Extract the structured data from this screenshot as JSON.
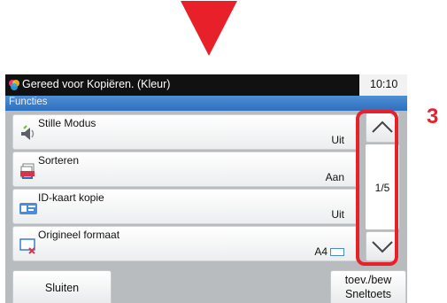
{
  "status_bar": {
    "status_text": "Gereed voor Kopiëren. (Kleur)",
    "time": "10:10",
    "status_icon": "color-copy-icon"
  },
  "header": {
    "title": "Functies"
  },
  "functions": [
    {
      "label": "Stille Modus",
      "value": "Uit",
      "icon": "quiet-mode-icon"
    },
    {
      "label": "Sorteren",
      "value": "Aan",
      "icon": "collate-icon"
    },
    {
      "label": "ID-kaart kopie",
      "value": "Uit",
      "icon": "id-card-icon"
    },
    {
      "label": "Origineel formaat",
      "value": "A4",
      "icon": "original-size-icon"
    }
  ],
  "scroll": {
    "page_indicator": "1/5",
    "up_icon": "chevron-up-icon",
    "down_icon": "chevron-down-icon"
  },
  "bottom": {
    "close_label": "Sluiten",
    "shortcut_line1": "toev./bew",
    "shortcut_line2": "Sneltoets"
  },
  "annotation": {
    "step_number": "3",
    "accent_color": "#e8202a"
  }
}
